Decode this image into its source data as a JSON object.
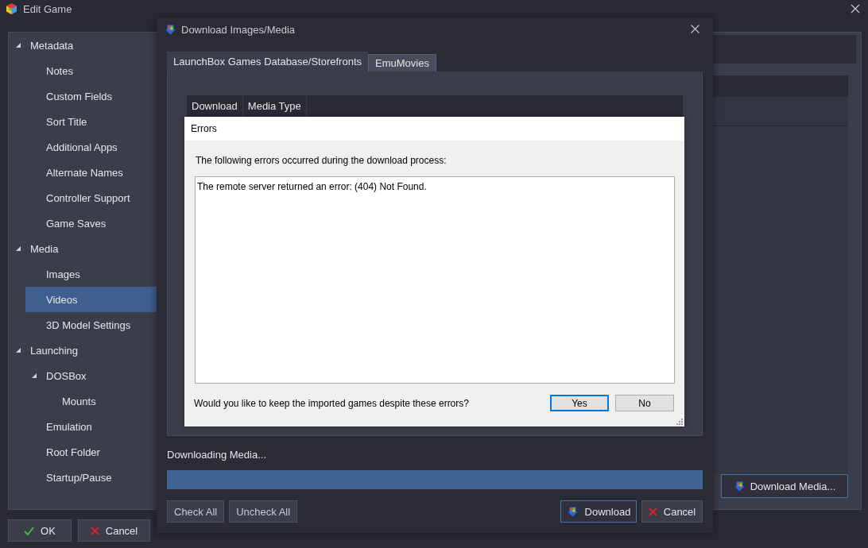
{
  "window": {
    "title": "Edit Game"
  },
  "sidebar": {
    "items": [
      {
        "label": "Metadata",
        "expanded": true,
        "selected": false,
        "children": [
          {
            "label": "Notes",
            "selected": false
          },
          {
            "label": "Custom Fields",
            "selected": false
          },
          {
            "label": "Sort Title",
            "selected": false
          },
          {
            "label": "Additional Apps",
            "selected": false
          },
          {
            "label": "Alternate Names",
            "selected": false
          },
          {
            "label": "Controller Support",
            "selected": false
          },
          {
            "label": "Game Saves",
            "selected": false
          }
        ]
      },
      {
        "label": "Media",
        "expanded": true,
        "selected": false,
        "children": [
          {
            "label": "Images",
            "selected": false
          },
          {
            "label": "Videos",
            "selected": true
          },
          {
            "label": "3D Model Settings",
            "selected": false
          }
        ]
      },
      {
        "label": "Launching",
        "expanded": true,
        "selected": false,
        "children": [
          {
            "label": "DOSBox",
            "expanded": true,
            "selected": false,
            "children": [
              {
                "label": "Mounts",
                "selected": false
              }
            ]
          },
          {
            "label": "Emulation",
            "selected": false
          },
          {
            "label": "Root Folder",
            "selected": false
          },
          {
            "label": "Startup/Pause",
            "selected": false
          }
        ]
      }
    ]
  },
  "side_button": {
    "label": "Download Media..."
  },
  "buttons": [
    {
      "label": "OK",
      "kind": "ok"
    },
    {
      "label": "Cancel",
      "kind": "cancel"
    }
  ],
  "download_dialog": {
    "title": "Download Images/Media",
    "tabs": [
      {
        "label": "LaunchBox Games Database/Storefronts",
        "selected": true
      },
      {
        "label": "EmuMovies",
        "selected": false
      }
    ],
    "list_columns": [
      "Download",
      "Media Type"
    ],
    "status": "Downloading Media...",
    "progress": {
      "level": 1
    },
    "left_buttons": [
      "Check All",
      "Uncheck All"
    ],
    "buttons": [
      {
        "label": "Download",
        "kind": "download",
        "default": true
      },
      {
        "label": "Cancel",
        "kind": "cancel",
        "default": false
      }
    ]
  },
  "errors_dialog": {
    "title": "Errors",
    "message": "The following errors occurred during the download process:",
    "details": "The remote server returned an error: (404) Not Found.",
    "question": "Would you like to keep the imported games despite these errors?",
    "buttons": [
      {
        "label": "Yes",
        "default": true
      },
      {
        "label": "No",
        "default": false
      }
    ]
  }
}
